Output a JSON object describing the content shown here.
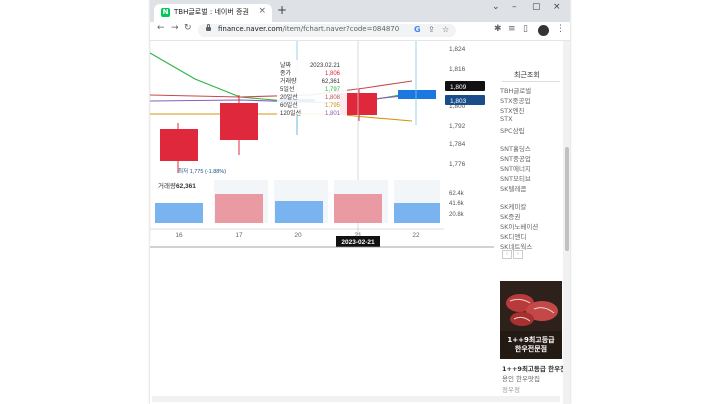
{
  "tab": {
    "favicon_text": "N",
    "title": "TBH글로벌 : 네이버 증권",
    "close": "×",
    "new_tab": "+"
  },
  "window_controls": {
    "collapse": "⌄",
    "minimize": "–",
    "maximize": "▢",
    "close": "×"
  },
  "nav": {
    "back": "←",
    "forward": "→",
    "reload": "↻"
  },
  "address": {
    "host": "finance.naver.com",
    "path": "/item/fchart.naver?code=084870"
  },
  "omnibox_icons": {
    "google": "G",
    "share": "⇪",
    "bookmark": "☆"
  },
  "toolbar_icons": {
    "extensions": "✱",
    "reading_list": "≡",
    "sidepanel": "▯",
    "menu": "⋮"
  },
  "chart": {
    "price_ticks": [
      "1,824",
      "1,816",
      "1,800",
      "1,792",
      "1,784",
      "1,776"
    ],
    "vol_ticks": [
      "62.4k",
      "41.6k",
      "20.8k"
    ],
    "x_labels": [
      "16",
      "17",
      "20",
      "21",
      "22"
    ],
    "price_tag_1": "1,809",
    "price_tag_2": "1,803",
    "crosshair_date": "2023-02-21",
    "low_annotation": "최저 1,775 (-1.88%)",
    "volume_label": "거래량",
    "volume_value": "62,361",
    "colors": {
      "up": "#e0283c",
      "down": "#1a78e0",
      "ma5": "#26b53f",
      "ma20": "#c74a4a",
      "ma60": "#d4960f",
      "ma120": "#8a5fbd"
    }
  },
  "tooltip": {
    "rows": [
      {
        "label": "날짜",
        "value": "2023.02.21"
      },
      {
        "label": "종가",
        "value": "1,806"
      },
      {
        "label": "거래량",
        "value": "62,361"
      },
      {
        "label": "5일선",
        "value": "1,797"
      },
      {
        "label": "20일선",
        "value": "1,808"
      },
      {
        "label": "60일선",
        "value": "1,795"
      },
      {
        "label": "120일선",
        "value": "1,801"
      }
    ]
  },
  "sidebar": {
    "header": "최근조회",
    "items": [
      "TBH글로벌",
      "STX중공업",
      "STX엔진",
      "STX",
      "SPC삼립",
      "SNT홀딩스",
      "SNT중공업",
      "SNT에너지",
      "SNT모티브",
      "SK텔레콤",
      "SK케미칼",
      "SK증권",
      "SK이노베이션",
      "SK디앤디",
      "SK네트웍스"
    ],
    "pager_prev": "‹",
    "pager_next": "›"
  },
  "ad": {
    "line1": "1++9최고등급",
    "line2": "한우전문점",
    "caption1": "1++9최고등급 한우전",
    "caption2": "용인 한우맛집",
    "caption3": "정우정"
  }
}
